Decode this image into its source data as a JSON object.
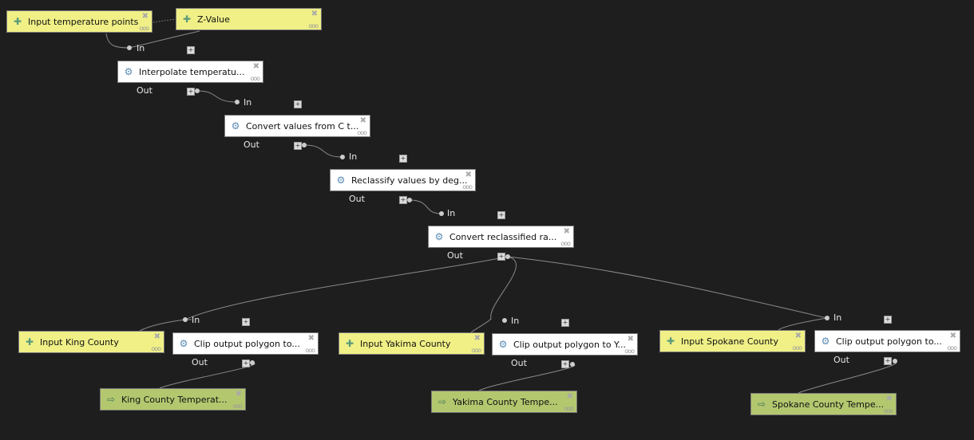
{
  "ports": {
    "in": "In",
    "out": "Out"
  },
  "icons": {
    "param": "plus-cross-icon",
    "alg_interpolate": "saga-icon",
    "alg_calc": "gear-icon",
    "alg_reclass": "grass-icon",
    "alg_clip": "vector-clip-icon",
    "output": "arrow-right-icon",
    "remove": "close-icon",
    "options": "ellipsis-icon"
  },
  "colors": {
    "background": "#1e1e1e",
    "parameter": "#f0f087",
    "algorithm": "#ffffff",
    "output": "#b3c76f"
  },
  "nodes": [
    {
      "label": "Input temperature points",
      "type": "param"
    },
    {
      "label": "Z-Value",
      "type": "param"
    },
    {
      "label": "Interpolate temperatu...",
      "type": "alg"
    },
    {
      "label": "Convert values from C t...",
      "type": "alg"
    },
    {
      "label": "Reclassify values by deg...",
      "type": "alg"
    },
    {
      "label": "Convert reclassified ra...",
      "type": "alg"
    },
    {
      "label": "Input King County",
      "type": "param"
    },
    {
      "label": "Clip output polygon to...",
      "type": "alg"
    },
    {
      "label": "Input Yakima County",
      "type": "param"
    },
    {
      "label": "Clip output polygon to Y...",
      "type": "alg"
    },
    {
      "label": "Input Spokane County",
      "type": "param"
    },
    {
      "label": "Clip output polygon to...",
      "type": "alg"
    },
    {
      "label": "King County Temperat...",
      "type": "out"
    },
    {
      "label": "Yakima County Tempe...",
      "type": "out"
    },
    {
      "label": "Spokane County Tempe...",
      "type": "out"
    }
  ]
}
